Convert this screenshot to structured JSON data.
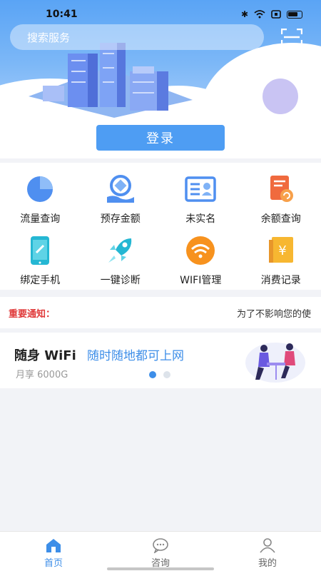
{
  "status_bar": {
    "time": "10:41"
  },
  "search": {
    "placeholder": "搜索服务"
  },
  "login": {
    "label": "登录"
  },
  "services": [
    {
      "label": "流量查询",
      "icon": "pie-chart-icon"
    },
    {
      "label": "预存金额",
      "icon": "deposit-icon"
    },
    {
      "label": "未实名",
      "icon": "id-card-icon"
    },
    {
      "label": "余额查询",
      "icon": "balance-document-icon"
    },
    {
      "label": "绑定手机",
      "icon": "phone-link-icon"
    },
    {
      "label": "一键诊断",
      "icon": "rocket-icon"
    },
    {
      "label": "WIFI管理",
      "icon": "wifi-icon"
    },
    {
      "label": "消费记录",
      "icon": "yen-record-icon"
    }
  ],
  "notice": {
    "title": "重要通知：",
    "text": "为了不影响您的使"
  },
  "banner": {
    "title": "随身 WiFi",
    "subtitle": "随时随地都可上网",
    "detail": "月享 6000G",
    "active_slide": 1,
    "slide_count": 2
  },
  "bottom_nav": [
    {
      "label": "首页",
      "icon": "home-icon",
      "active": true
    },
    {
      "label": "咨询",
      "icon": "chat-icon",
      "active": false
    },
    {
      "label": "我的",
      "icon": "user-icon",
      "active": false
    }
  ],
  "colors": {
    "primary": "#4e9df3",
    "accent": "#3d8ee8",
    "notice_red": "#e03a3a"
  }
}
